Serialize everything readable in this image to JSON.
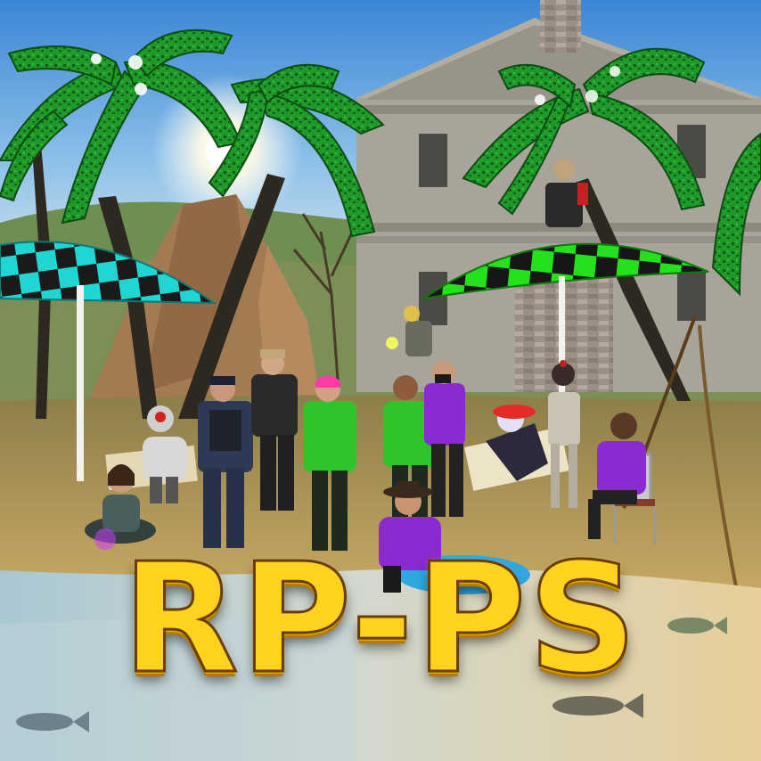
{
  "title": {
    "text": "RP-PS"
  },
  "colors": {
    "title_fill": "#ffd21e",
    "title_outline": "#6a3d00",
    "umbrella_left": "#1fd6d2",
    "umbrella_right": "#1ee21a",
    "sky": "#7fb2de",
    "sand": "#c9ad6a",
    "water": "#8fb6c6"
  },
  "icons": {
    "sun": "sun-icon",
    "palm": "palm-tree-icon",
    "umbrella": "beach-umbrella-icon",
    "fish": "fish-icon",
    "house": "house-icon"
  }
}
